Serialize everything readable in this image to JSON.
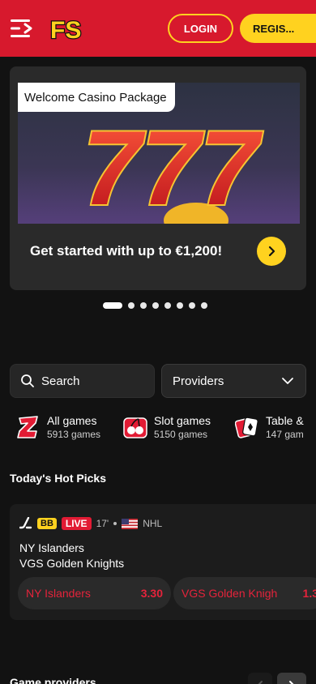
{
  "header": {
    "menu_icon": "menu-icon",
    "logo_text": "FS",
    "login_label": "LOGIN",
    "register_label": "REGIS...",
    "accent": "#d7192d",
    "brand_yellow": "#ffd21f"
  },
  "promo": {
    "badge": "Welcome Casino Package",
    "headline": "Get started with up to €1,200!",
    "image_text": "777",
    "arrow_icon": "chevron-right-icon",
    "slides_total": 8,
    "active_slide": 1
  },
  "filters": {
    "search_label": "Search",
    "search_icon": "search-icon",
    "providers_label": "Providers",
    "providers_icon": "chevron-down-icon"
  },
  "categories": [
    {
      "name": "All games",
      "count": "5913 games",
      "icon": "z-logo-icon"
    },
    {
      "name": "Slot games",
      "count": "5150 games",
      "icon": "cherries-icon"
    },
    {
      "name": "Table &",
      "count": "147 gam",
      "icon": "playing-cards-icon"
    }
  ],
  "hot_picks": {
    "title": "Today's Hot Picks",
    "match": {
      "sport_icon": "hockey-stick-icon",
      "bb_badge": "BB",
      "live_badge": "LIVE",
      "minute": "17'",
      "flag_icon": "us-flag-icon",
      "league": "NHL",
      "team_home": "NY Islanders",
      "team_away": "VGS Golden Knights",
      "odds": [
        {
          "label": "NY Islanders",
          "value": "3.30"
        },
        {
          "label": "VGS Golden Knigh",
          "value": "1.3"
        }
      ]
    }
  },
  "game_providers": {
    "title": "Game providers",
    "prev_icon": "chevron-left-icon",
    "next_icon": "chevron-right-icon"
  }
}
